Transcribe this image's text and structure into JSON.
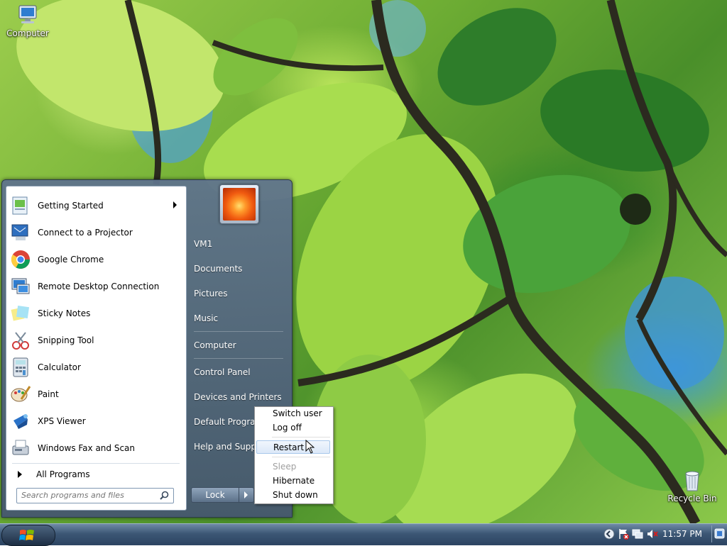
{
  "desktop": {
    "icons": [
      {
        "label": "Computer",
        "icon": "computer-icon"
      },
      {
        "label": "Recycle Bin",
        "icon": "recycle-bin-icon"
      }
    ]
  },
  "start_menu": {
    "programs": [
      {
        "label": "Getting Started",
        "icon": "getting-started-icon",
        "has_submenu": true
      },
      {
        "label": "Connect to a Projector",
        "icon": "projector-icon"
      },
      {
        "label": "Google Chrome",
        "icon": "chrome-icon"
      },
      {
        "label": "Remote Desktop Connection",
        "icon": "remote-desktop-icon"
      },
      {
        "label": "Sticky Notes",
        "icon": "sticky-notes-icon"
      },
      {
        "label": "Snipping Tool",
        "icon": "snipping-tool-icon"
      },
      {
        "label": "Calculator",
        "icon": "calculator-icon"
      },
      {
        "label": "Paint",
        "icon": "paint-icon"
      },
      {
        "label": "XPS Viewer",
        "icon": "xps-viewer-icon"
      },
      {
        "label": "Windows Fax and Scan",
        "icon": "fax-scan-icon"
      }
    ],
    "all_programs": "All Programs",
    "search_placeholder": "Search programs and files",
    "right_items": [
      {
        "label": "VM1"
      },
      {
        "label": "Documents"
      },
      {
        "label": "Pictures"
      },
      {
        "label": "Music"
      },
      {
        "label": "Computer"
      },
      {
        "label": "Control Panel"
      },
      {
        "label": "Devices and Printers"
      },
      {
        "label": "Default Programs"
      },
      {
        "label": "Help and Support"
      }
    ],
    "lock_label": "Lock"
  },
  "power_menu": {
    "items": [
      {
        "label": "Switch user",
        "state": "enabled"
      },
      {
        "label": "Log off",
        "state": "enabled"
      },
      {
        "label": "Restart",
        "state": "hover"
      },
      {
        "label": "Sleep",
        "state": "disabled"
      },
      {
        "label": "Hibernate",
        "state": "enabled"
      },
      {
        "label": "Shut down",
        "state": "enabled"
      }
    ]
  },
  "taskbar": {
    "start_icon": "windows-logo-icon",
    "tray_icons": [
      "show-hidden-icons-icon",
      "action-center-flag-icon",
      "network-icon",
      "volume-muted-icon"
    ],
    "clock": "11:57 PM"
  }
}
